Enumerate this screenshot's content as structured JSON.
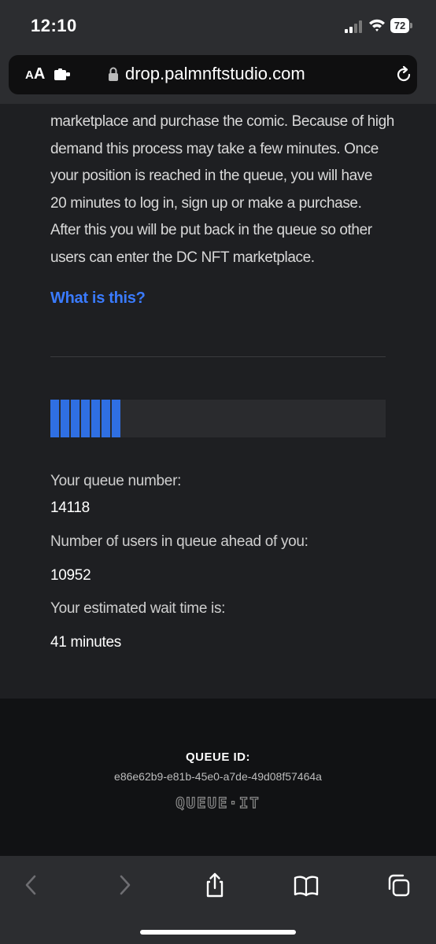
{
  "status_bar": {
    "time": "12:10",
    "battery": "72"
  },
  "browser": {
    "text_size_label_small": "A",
    "text_size_label_large": "A",
    "url": "drop.palmnftstudio.com"
  },
  "queue_page": {
    "intro_lines": [
      "marketplace and purchase the comic. Because of high",
      "demand this process may take a few minutes. Once",
      "your position is reached in the queue, you will have",
      "20 minutes to log in, sign up or make a purchase.",
      "After this you will be put back in the queue so other",
      "users can enter the DC NFT marketplace."
    ],
    "what_is_this": "What is this?",
    "progress_fraction": 0.22,
    "progress_color": "#2f6fe3",
    "queue_number_label": "Your queue number:",
    "queue_number": "14118",
    "ahead_label": "Number of users in queue ahead of you:",
    "ahead_value": "10952",
    "wait_label": "Your estimated wait time is:",
    "wait_value": "41 minutes"
  },
  "footer": {
    "queue_id_label": "QUEUE ID:",
    "queue_id": "e86e62b9-e81b-45e0-a7de-49d08f57464a",
    "logo_text": "QUEUE·IT"
  },
  "toolbar": {
    "icons": [
      "back-icon",
      "forward-icon",
      "share-icon",
      "bookmarks-icon",
      "tabs-icon"
    ]
  }
}
